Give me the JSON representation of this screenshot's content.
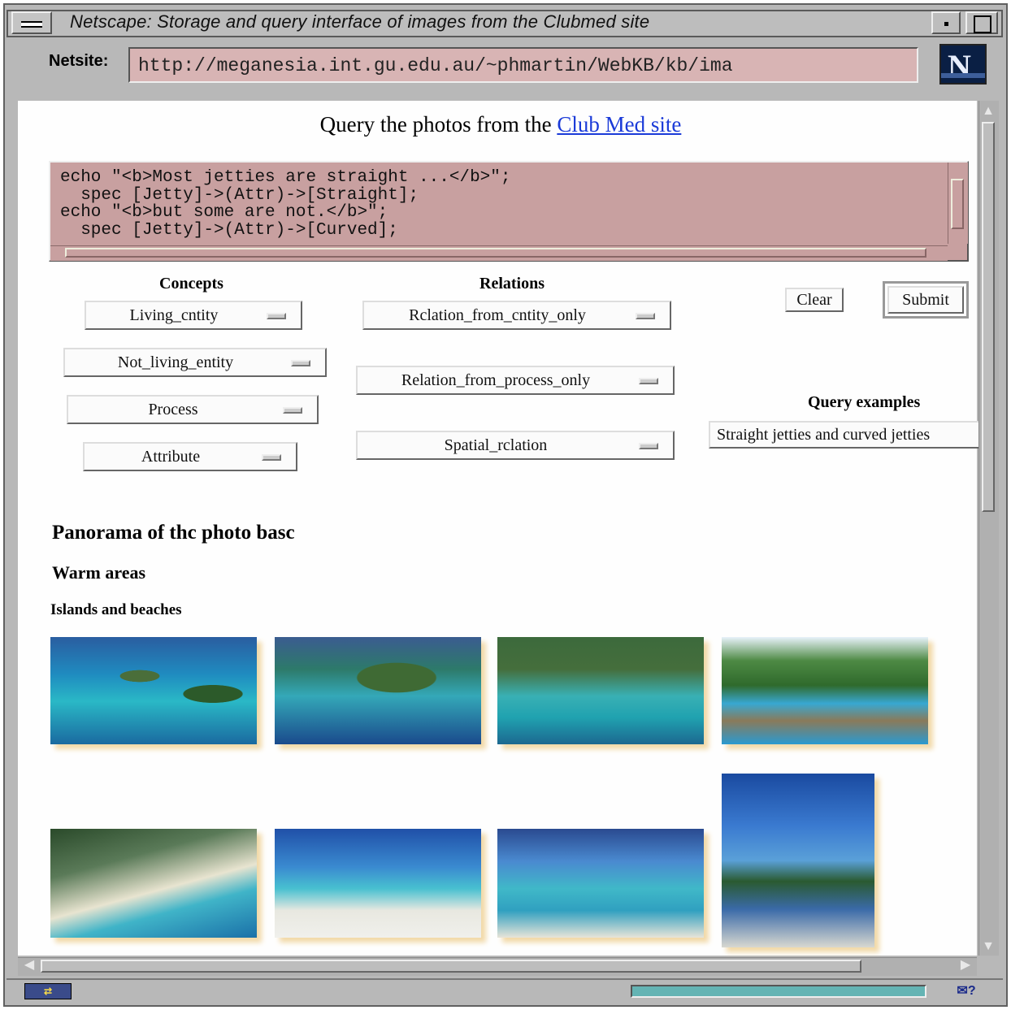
{
  "window": {
    "title": "Netscape: Storage and query interface of images from the Clubmed site",
    "netsite_label": "Netsite:",
    "url": "http://meganesia.int.gu.edu.au/~phmartin/WebKB/kb/ima",
    "logo_letter": "N"
  },
  "page": {
    "heading_prefix": "Query the photos from the ",
    "heading_link": "Club Med site",
    "query_text": "echo \"<b>Most jetties are straight ...</b>\";\n  spec [Jetty]->(Attr)->[Straight];\necho \"<b>but some are not.</b>\";\n  spec [Jetty]->(Attr)->[Curved];",
    "concepts_header": "Concepts",
    "relations_header": "Relations",
    "concepts": [
      "Living_cntity",
      "Not_living_entity",
      "Process",
      "Attribute"
    ],
    "relations": [
      "Rclation_from_cntity_only",
      "Relation_from_process_only",
      "Spatial_rclation"
    ],
    "clear_button": "Clear",
    "submit_button": "Submit",
    "query_examples_header": "Query examples",
    "query_example_selected": "Straight jetties and curved jetties",
    "panorama_heading": "Panorama of thc photo basc",
    "warm_heading": "Warm areas",
    "islands_heading": "Islands and beaches"
  },
  "status": {
    "icon_label": "⇄",
    "mail_label": "✉?"
  }
}
